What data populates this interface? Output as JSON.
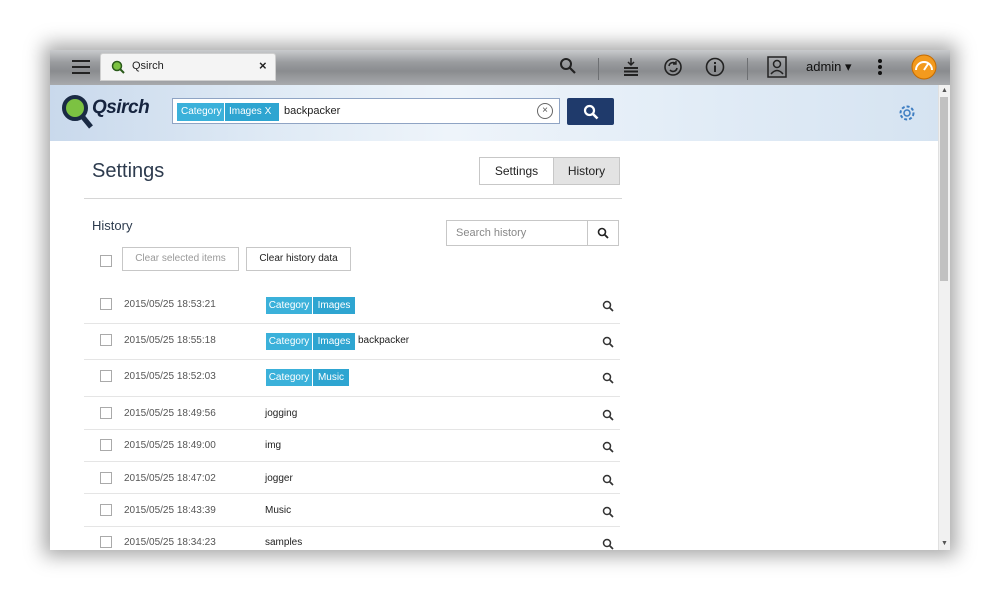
{
  "app": {
    "tab_title": "Qsirch",
    "tab_close": "×",
    "logo_text": "Qsirch"
  },
  "topbar": {
    "user": "admin ▾",
    "icons": [
      "menu-icon",
      "search-icon",
      "stack-icon",
      "sync-icon",
      "info-icon",
      "user-icon",
      "more-icon",
      "dashboard-icon"
    ]
  },
  "search": {
    "chips": [
      {
        "label": "Category"
      },
      {
        "label": "Images X"
      }
    ],
    "query": "backpacker",
    "clear": "×"
  },
  "page": {
    "title": "Settings",
    "tabs": [
      "Settings",
      "History"
    ],
    "active_tab": "History",
    "section": "History"
  },
  "history": {
    "search_placeholder": "Search history",
    "clear_selected": "Clear selected items",
    "clear_all": "Clear history data",
    "rows": [
      {
        "time": "2015/05/25 18:53:21",
        "category": "Category",
        "value": "Images",
        "query": ""
      },
      {
        "time": "2015/05/25 18:55:18",
        "category": "Category",
        "value": "Images",
        "query": "backpacker"
      },
      {
        "time": "2015/05/25 18:52:03",
        "category": "Category",
        "value": "Music",
        "query": ""
      },
      {
        "time": "2015/05/25 18:49:56",
        "term": "jogging"
      },
      {
        "time": "2015/05/25 18:49:00",
        "term": "img"
      },
      {
        "time": "2015/05/25 18:47:02",
        "term": "jogger"
      },
      {
        "time": "2015/05/25 18:43:39",
        "term": "Music"
      },
      {
        "time": "2015/05/25 18:34:23",
        "term": "samples"
      }
    ]
  },
  "colors": {
    "accent": "#1f3a6b",
    "chip": "#3bb1da",
    "chip_dark": "#2ea5d1"
  }
}
